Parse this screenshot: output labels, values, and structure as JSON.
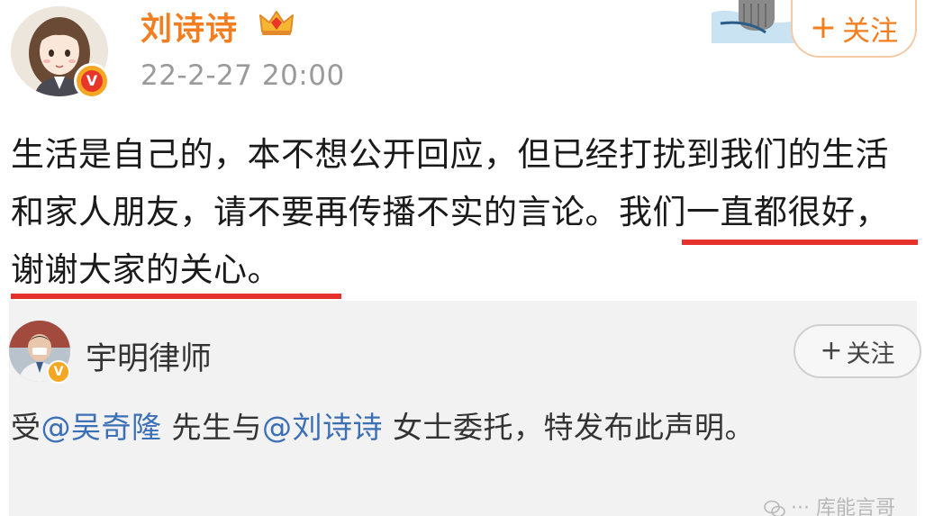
{
  "post": {
    "username": "刘诗诗",
    "timestamp": "22-2-27 20:00",
    "verified_badge": "V",
    "follow_plus": "+",
    "follow_label": "关注",
    "text_part1": "生活是自己的，本不想公开回应，但已经打扰到我们的生活和家人朋友，请不要再传播不实的言论。",
    "text_part2": "我们一直都很好，谢谢大家的关心。",
    "highlight_color": "#e5322d",
    "name_color": "#f47d1f",
    "icons": {
      "vip": "crown-icon",
      "decoration": "cup-decoration-icon"
    }
  },
  "repost": {
    "username": "宇明律师",
    "verified_badge": "V",
    "follow_plus": "+",
    "follow_label": "关注",
    "text": {
      "prefix": "受",
      "mention1": "@吴奇隆",
      "middle": " 先生与",
      "mention2": "@刘诗诗",
      "suffix": " 女士委托，特发布此声明。"
    },
    "mention_color": "#3b6fb6"
  },
  "watermark": {
    "text": "··· 库能言哥",
    "icon": "wechat-icon"
  }
}
